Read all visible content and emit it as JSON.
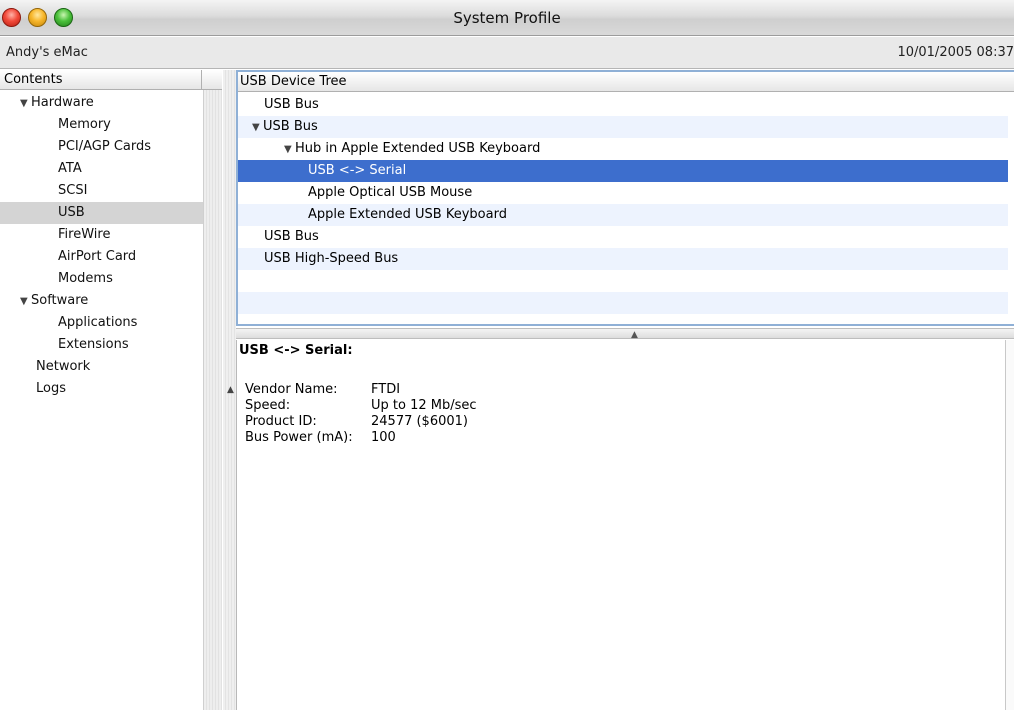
{
  "window": {
    "title": "System Profile"
  },
  "infobar": {
    "computer_name": "Andy's eMac",
    "datetime": "10/01/2005 08:37"
  },
  "sidebar": {
    "header": "Contents",
    "items": [
      {
        "label": "Hardware",
        "expanded": true,
        "selected": false
      },
      {
        "label": "Memory",
        "selected": false
      },
      {
        "label": "PCI/AGP Cards",
        "selected": false
      },
      {
        "label": "ATA",
        "selected": false
      },
      {
        "label": "SCSI",
        "selected": false
      },
      {
        "label": "USB",
        "selected": true
      },
      {
        "label": "FireWire",
        "selected": false
      },
      {
        "label": "AirPort Card",
        "selected": false
      },
      {
        "label": "Modems",
        "selected": false
      },
      {
        "label": "Software",
        "expanded": true,
        "selected": false
      },
      {
        "label": "Applications",
        "selected": false
      },
      {
        "label": "Extensions",
        "selected": false
      },
      {
        "label": "Network",
        "selected": false
      },
      {
        "label": "Logs",
        "selected": false
      }
    ]
  },
  "tree": {
    "header": "USB Device Tree",
    "rows": [
      {
        "label": "USB Bus",
        "expanded": false,
        "selected": false
      },
      {
        "label": "USB Bus",
        "expanded": true,
        "selected": false
      },
      {
        "label": "Hub in Apple Extended USB Keyboard",
        "expanded": true,
        "selected": false
      },
      {
        "label": "USB <-> Serial",
        "selected": true
      },
      {
        "label": "Apple Optical USB Mouse",
        "selected": false
      },
      {
        "label": "Apple Extended USB Keyboard",
        "selected": false
      },
      {
        "label": "USB Bus",
        "selected": false
      },
      {
        "label": "USB High-Speed Bus",
        "selected": false
      }
    ]
  },
  "detail": {
    "title": "USB <-> Serial:",
    "fields": [
      {
        "key": "Vendor Name:",
        "value": "FTDI"
      },
      {
        "key": "Speed:",
        "value": "Up to 12 Mb/sec"
      },
      {
        "key": "Product ID:",
        "value": "24577 ($6001)"
      },
      {
        "key": "Bus Power (mA):",
        "value": "100"
      }
    ]
  },
  "colors": {
    "selection": "#3d6ecd",
    "sidebar_selection": "#d4d4d4",
    "alt_row": "#edf3fe"
  },
  "icons": {
    "expanded": "disclosure-triangle-down-icon",
    "splitter": "splitter-grip-icon"
  }
}
